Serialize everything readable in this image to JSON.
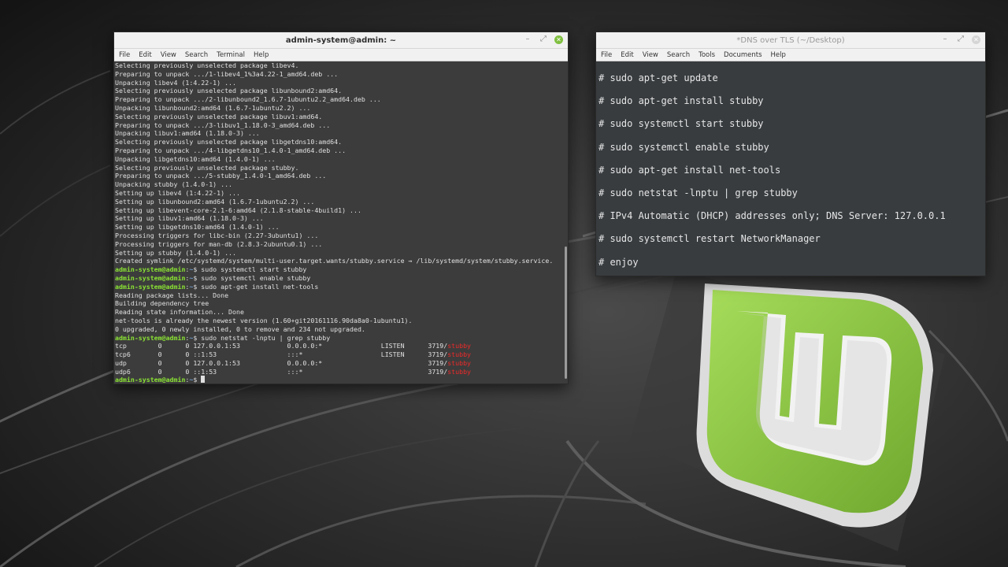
{
  "terminal": {
    "title": "admin-system@admin: ~",
    "menu": [
      "File",
      "Edit",
      "View",
      "Search",
      "Terminal",
      "Help"
    ],
    "prompt_user": "admin-system@admin",
    "prompt_path": "~",
    "prompt_symbol": "$",
    "lines": [
      {
        "type": "out",
        "text": "Selecting previously unselected package libev4."
      },
      {
        "type": "out",
        "text": "Preparing to unpack .../1-libev4_1%3a4.22-1_amd64.deb ..."
      },
      {
        "type": "out",
        "text": "Unpacking libev4 (1:4.22-1) ..."
      },
      {
        "type": "out",
        "text": "Selecting previously unselected package libunbound2:amd64."
      },
      {
        "type": "out",
        "text": "Preparing to unpack .../2-libunbound2_1.6.7-1ubuntu2.2_amd64.deb ..."
      },
      {
        "type": "out",
        "text": "Unpacking libunbound2:amd64 (1.6.7-1ubuntu2.2) ..."
      },
      {
        "type": "out",
        "text": "Selecting previously unselected package libuv1:amd64."
      },
      {
        "type": "out",
        "text": "Preparing to unpack .../3-libuv1_1.18.0-3_amd64.deb ..."
      },
      {
        "type": "out",
        "text": "Unpacking libuv1:amd64 (1.18.0-3) ..."
      },
      {
        "type": "out",
        "text": "Selecting previously unselected package libgetdns10:amd64."
      },
      {
        "type": "out",
        "text": "Preparing to unpack .../4-libgetdns10_1.4.0-1_amd64.deb ..."
      },
      {
        "type": "out",
        "text": "Unpacking libgetdns10:amd64 (1.4.0-1) ..."
      },
      {
        "type": "out",
        "text": "Selecting previously unselected package stubby."
      },
      {
        "type": "out",
        "text": "Preparing to unpack .../5-stubby_1.4.0-1_amd64.deb ..."
      },
      {
        "type": "out",
        "text": "Unpacking stubby (1.4.0-1) ..."
      },
      {
        "type": "out",
        "text": "Setting up libev4 (1:4.22-1) ..."
      },
      {
        "type": "out",
        "text": "Setting up libunbound2:amd64 (1.6.7-1ubuntu2.2) ..."
      },
      {
        "type": "out",
        "text": "Setting up libevent-core-2.1-6:amd64 (2.1.8-stable-4build1) ..."
      },
      {
        "type": "out",
        "text": "Setting up libuv1:amd64 (1.18.0-3) ..."
      },
      {
        "type": "out",
        "text": "Setting up libgetdns10:amd64 (1.4.0-1) ..."
      },
      {
        "type": "out",
        "text": "Processing triggers for libc-bin (2.27-3ubuntu1) ..."
      },
      {
        "type": "out",
        "text": "Processing triggers for man-db (2.8.3-2ubuntu0.1) ..."
      },
      {
        "type": "out",
        "text": "Setting up stubby (1.4.0-1) ..."
      },
      {
        "type": "out",
        "text": "Created symlink /etc/systemd/system/multi-user.target.wants/stubby.service → /lib/systemd/system/stubby.service."
      },
      {
        "type": "cmd",
        "text": "sudo systemctl start stubby"
      },
      {
        "type": "cmd",
        "text": "sudo systemctl enable stubby"
      },
      {
        "type": "cmd",
        "text": "sudo apt-get install net-tools"
      },
      {
        "type": "out",
        "text": "Reading package lists... Done"
      },
      {
        "type": "out",
        "text": "Building dependency tree"
      },
      {
        "type": "out",
        "text": "Reading state information... Done"
      },
      {
        "type": "out",
        "text": "net-tools is already the newest version (1.60+git20161116.90da8a0-1ubuntu1)."
      },
      {
        "type": "out",
        "text": "0 upgraded, 0 newly installed, 0 to remove and 234 not upgraded."
      },
      {
        "type": "cmd",
        "text": "sudo netstat -lnptu | grep stubby"
      },
      {
        "type": "net",
        "text": "tcp        0      0 127.0.0.1:53            0.0.0.0:*               LISTEN      3719/",
        "hl": "stubby"
      },
      {
        "type": "net",
        "text": "tcp6       0      0 ::1:53                  :::*                    LISTEN      3719/",
        "hl": "stubby"
      },
      {
        "type": "net",
        "text": "udp        0      0 127.0.0.1:53            0.0.0.0:*                           3719/",
        "hl": "stubby"
      },
      {
        "type": "net",
        "text": "udp6       0      0 ::1:53                  :::*                                3719/",
        "hl": "stubby"
      },
      {
        "type": "prompt",
        "text": ""
      }
    ]
  },
  "editor": {
    "title": "*DNS over TLS (~/Desktop)",
    "menu": [
      "File",
      "Edit",
      "View",
      "Search",
      "Tools",
      "Documents",
      "Help"
    ],
    "lines": [
      "# sudo apt-get update",
      "# sudo apt-get install stubby",
      "# sudo systemctl start stubby",
      "# sudo systemctl enable stubby",
      "# sudo apt-get install net-tools",
      "# sudo netstat -lnptu | grep stubby",
      "# IPv4 Automatic (DHCP) addresses only; DNS Server: 127.0.0.1",
      "# sudo systemctl restart NetworkManager",
      "# enjoy"
    ]
  },
  "colors": {
    "mint_green": "#8cc63f",
    "prompt_green": "#8ae234",
    "prompt_path_blue": "#729fcf",
    "highlight_red": "#ef2929"
  },
  "icons": {
    "minimize": "minimize-icon",
    "maximize": "maximize-icon",
    "close": "close-icon",
    "desktop_logo": "linux-mint-logo-icon"
  }
}
